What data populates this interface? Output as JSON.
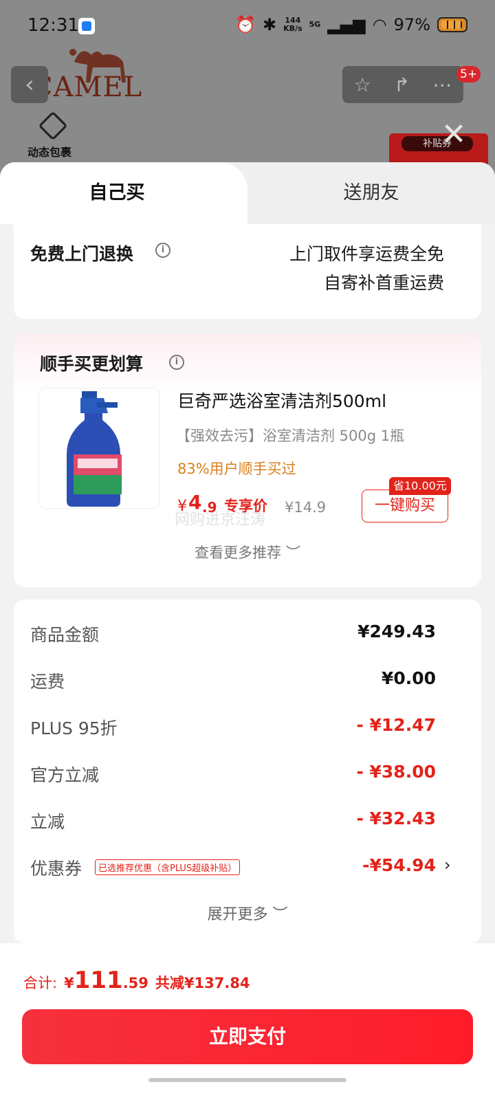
{
  "status_bar": {
    "time": "12:31",
    "speed_top": "144",
    "speed_unit": "KB/s",
    "network": "5G",
    "battery": "97%"
  },
  "background": {
    "brand": "CAMEL",
    "pack_label": "动态包裹",
    "badge": "5+",
    "subsidy": "补贴券"
  },
  "tabs": {
    "self": "自己买",
    "friend": "送朋友"
  },
  "return_card": {
    "title": "免费上门退换",
    "line1": "上门取件享运费全免",
    "line2": "自寄补首重运费"
  },
  "recommend": {
    "title": "顺手买更划算",
    "product_name": "巨奇严选浴室清洁剂500ml",
    "spec": "【强效去污】浴室清洁剂 500g 1瓶",
    "buyers": "83%用户顺手买过",
    "price_symbol": "¥",
    "price_int": "4",
    "price_dec": ".9",
    "price_label": "专享价",
    "orig_price": "¥14.9",
    "save_tag": "省10.00元",
    "buy_button": "一键购买",
    "watermark": "网购进京汪涛",
    "more": "查看更多推荐 ︶"
  },
  "summary": {
    "rows": [
      {
        "label": "商品金额",
        "value": "¥249.43"
      },
      {
        "label": "运费",
        "value": "¥0.00"
      },
      {
        "label": "PLUS 95折",
        "value": "- ¥12.47"
      },
      {
        "label": "官方立减",
        "value": "- ¥38.00"
      },
      {
        "label": "立减",
        "value": "- ¥32.43"
      },
      {
        "label": "优惠券",
        "value": "-¥54.94"
      }
    ],
    "coupon_tag": "已选推荐优惠（含PLUS超级补贴）",
    "expand": "展开更多 ︶"
  },
  "footer": {
    "total_label": "合计:",
    "total_symbol": "¥",
    "total_int": "111",
    "total_dec": ".59",
    "total_saved": "共减¥137.84",
    "pay_button": "立即支付"
  },
  "colors": {
    "accent": "#e2231a",
    "buyers": "#d9801f"
  }
}
